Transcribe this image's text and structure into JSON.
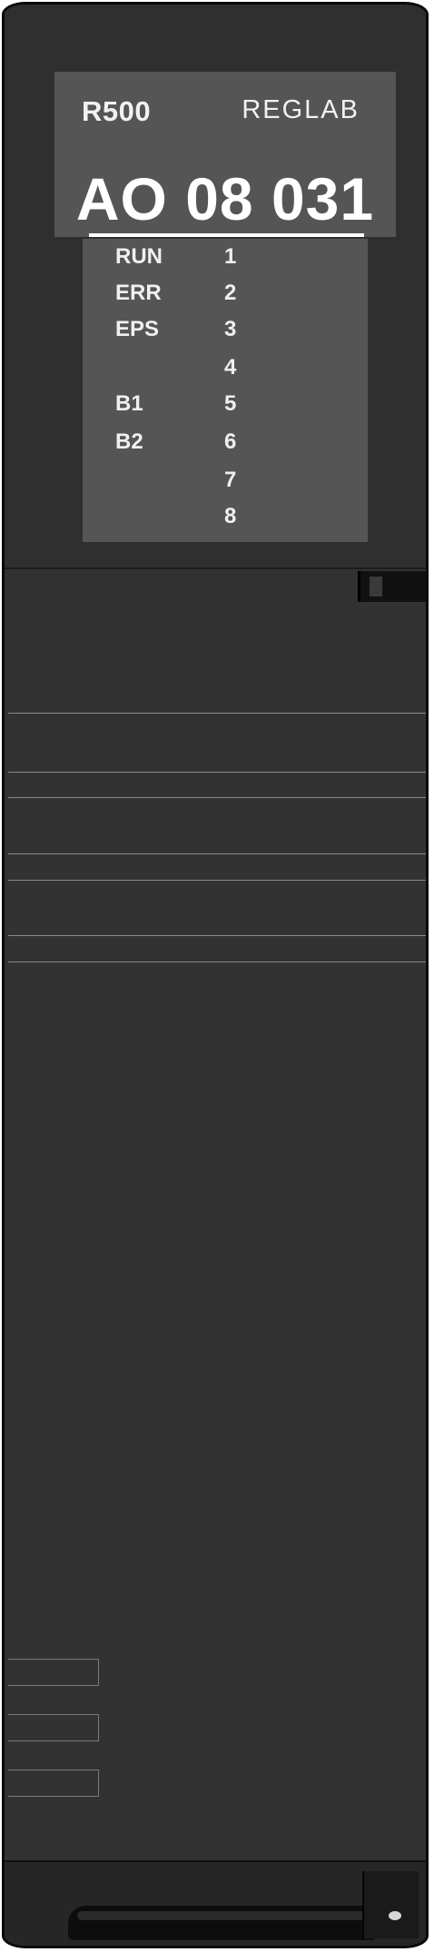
{
  "module": {
    "model": "R500",
    "brand": "REGLAB",
    "product_code": "AO 08 031"
  },
  "leds": [
    {
      "name": "RUN",
      "num": "1"
    },
    {
      "name": "ERR",
      "num": "2"
    },
    {
      "name": "EPS",
      "num": "3"
    },
    {
      "name": "",
      "num": "4"
    },
    {
      "name": "B1",
      "num": "5"
    },
    {
      "name": "B2",
      "num": "6"
    },
    {
      "name": "",
      "num": "7"
    },
    {
      "name": "",
      "num": "8"
    }
  ]
}
